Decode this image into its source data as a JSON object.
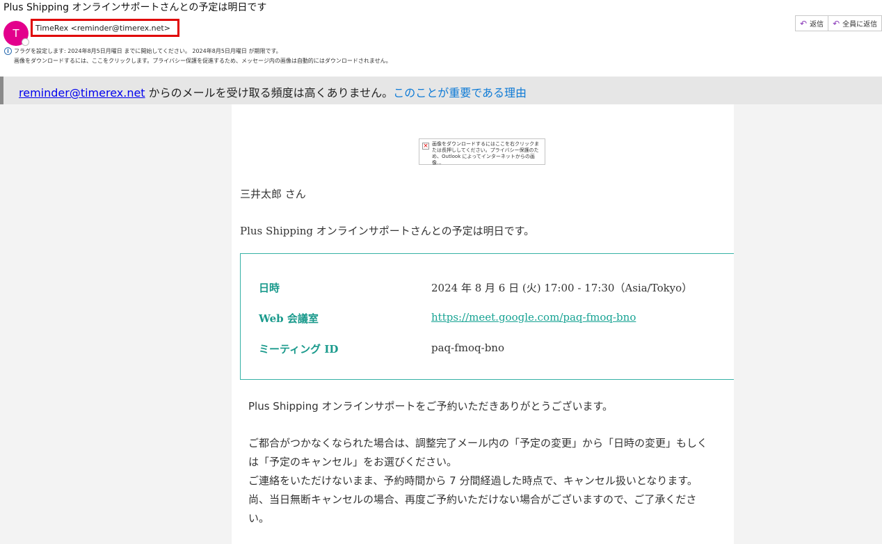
{
  "email": {
    "subject": "Plus Shipping オンラインサポートさんとの予定は明日です",
    "avatar_initial": "T",
    "sender": "TimeRex <reminder@timerex.net>"
  },
  "actions": {
    "reply_label": "返信",
    "reply_all_label": "全員に返信",
    "reply_icon": "reply-icon",
    "reply_all_icon": "reply-all-icon"
  },
  "info": {
    "icon": "info-icon",
    "flag_line": "フラグを設定します:  2024年8月5日月曜日 までに開始してください。  2024年8月5日月曜日 が期限です。",
    "images_line": "画像をダウンロードするには、ここをクリックします。プライバシー保護を促進するため、メッセージ内の画像は自動的にはダウンロードされません。"
  },
  "banner": {
    "email_link": "reminder@timerex.net",
    "text": " からのメールを受け取る頻度は高くありません。",
    "why_link": "このことが重要である理由"
  },
  "image_placeholder": {
    "icon": "broken-image-icon",
    "text": "画像をダウンロードするにはここを右クリックまたは長押ししてください。プライバシー保護のため、Outlook によってインターネットからの画像..."
  },
  "body": {
    "greeting": "三井太郎 さん",
    "intro": "Plus Shipping オンラインサポートさんとの予定は明日です。",
    "details": [
      {
        "label": "日時",
        "value": "2024 年 8 月 6 日 (火) 17:00 - 17:30（Asia/Tokyo）"
      },
      {
        "label": "Web 会議室",
        "value": "https://meet.google.com/paq-fmoq-bno"
      },
      {
        "label": "ミーティング ID",
        "value": "paq-fmoq-bno"
      }
    ],
    "thanks": "Plus Shipping オンラインサポートをご予約いただきありがとうございます。",
    "para_lines": [
      "ご都合がつかなくなられた場合は、調整完了メール内の「予定の変更」から「日時の変更」もしく",
      "は「予定のキャンセル」をお選びください。",
      "ご連絡をいただけないまま、予約時間から 7 分間経過した時点で、キャンセル扱いとなります。",
      "尚、当日無断キャンセルの場合、再度ご予約いただけない場合がございますので、ご了承くださ",
      "い。"
    ]
  },
  "colors": {
    "avatar": "#e3008c",
    "highlight_box": "#e00000",
    "teal": "#1a9a8c",
    "link_blue": "#0f7bd6"
  }
}
